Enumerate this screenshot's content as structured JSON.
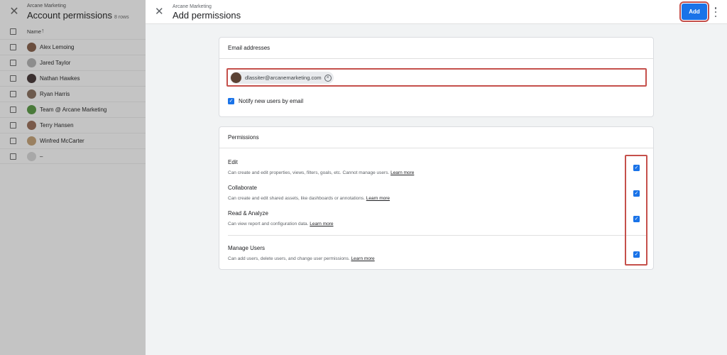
{
  "background": {
    "org": "Arcane Marketing",
    "title": "Account permissions",
    "rows_label": "8 rows",
    "column_header": "Name",
    "rows": [
      {
        "name": "Alex Lemoing",
        "avatar_color": "#6b4f3f"
      },
      {
        "name": "Jared Taylor",
        "avatar_color": "#8d8d8d"
      },
      {
        "name": "Nathan Hawkes",
        "avatar_color": "#3b3030"
      },
      {
        "name": "Ryan Harris",
        "avatar_color": "#6d5a4d"
      },
      {
        "name": "Team @ Arcane Marketing",
        "avatar_color": "#4a7a3a"
      },
      {
        "name": "Terry Hansen",
        "avatar_color": "#7a5a4a"
      },
      {
        "name": "Winfred McCarter",
        "avatar_color": "#9a8060"
      },
      {
        "name": "–",
        "avatar_color": "#a8a8a8"
      }
    ]
  },
  "panel": {
    "org": "Arcane Marketing",
    "title": "Add permissions",
    "add_label": "Add"
  },
  "email_card": {
    "heading": "Email addresses",
    "chip_email": "dlassiter@arcanemarketing.com",
    "notify_label": "Notify new users by email",
    "notify_checked": true
  },
  "permissions_card": {
    "heading": "Permissions",
    "items": [
      {
        "title": "Edit",
        "desc": "Can create and edit properties, views, filters, goals, etc. Cannot manage users.",
        "link": "Learn more",
        "checked": true
      },
      {
        "title": "Collaborate",
        "desc": "Can create and edit shared assets, like dashboards or annotations.",
        "link": "Learn more",
        "checked": true
      },
      {
        "title": "Read & Analyze",
        "desc": "Can view report and configuration data.",
        "link": "Learn more",
        "checked": true
      },
      {
        "title": "Manage Users",
        "desc": "Can add users, delete users, and change user permissions.",
        "link": "Learn more",
        "checked": true
      }
    ]
  },
  "colors": {
    "accent": "#1a73e8",
    "highlight": "#c5504b"
  }
}
